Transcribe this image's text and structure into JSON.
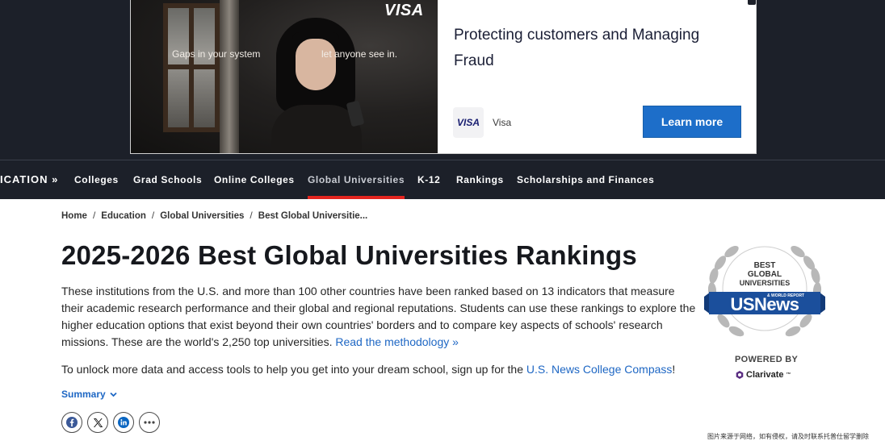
{
  "ad": {
    "caption_left": "Gaps in your system",
    "caption_right": "let anyone see in.",
    "image_logo": "VISA",
    "headline": "Protecting customers and Managing Fraud",
    "brand_badge": "VISA",
    "brand_name": "Visa",
    "cta_label": "Learn more"
  },
  "nav": {
    "brand": "ICATION »",
    "items": [
      "Colleges",
      "Grad Schools",
      "Online Colleges",
      "Global Universities",
      "K-12",
      "Rankings",
      "Scholarships and Finances"
    ],
    "active": "Global Universities"
  },
  "breadcrumb": {
    "items": [
      "Home",
      "Education",
      "Global Universities",
      "Best Global Universitie..."
    ],
    "separator": "/"
  },
  "main": {
    "title": "2025-2026 Best Global Universities Rankings",
    "intro_text": "These institutions from the U.S. and more than 100 other countries have been ranked based on 13 indicators that measure their academic research performance and their global and regional reputations. Students can use these rankings to explore the higher education options that exist beyond their own countries' borders and to compare key aspects of schools' research missions. These are the world's 2,250 top universities. ",
    "methodology_link": "Read the methodology »",
    "cta_text": "To unlock more data and access tools to help you get into your dream school, sign up for the ",
    "cta_link": "U.S. News College Compass",
    "cta_end": "!",
    "summary_label": "Summary"
  },
  "share": {
    "icons": [
      "facebook-icon",
      "x-icon",
      "linkedin-icon",
      "more-icon"
    ]
  },
  "badge": {
    "line1": "BEST",
    "line2": "GLOBAL",
    "line3": "UNIVERSITIES",
    "ribbon_small": "& WORLD REPORT",
    "ribbon_main": "USNews",
    "powered_by": "POWERED BY",
    "clarivate": "Clarivate",
    "clarivate_tm": "™"
  },
  "watermark": "图片来源于网络，如有侵权，请及时联系托普仕留学删除",
  "colors": {
    "nav_bg": "#1c2029",
    "accent_red": "#e3251f",
    "link_blue": "#1e67c4",
    "cta_blue": "#1d6ec9",
    "badge_blue": "#1b4f9c"
  }
}
